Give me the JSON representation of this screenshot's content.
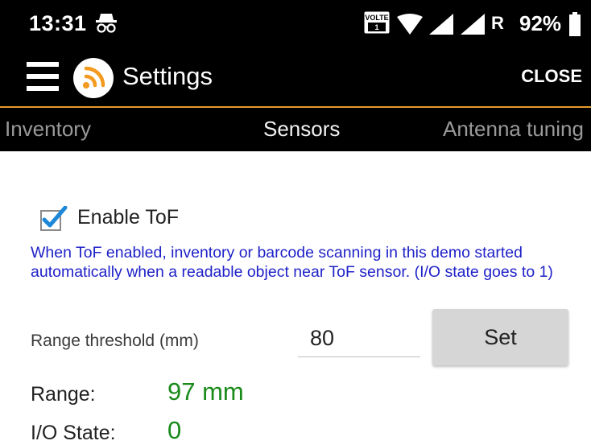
{
  "status_bar": {
    "time": "13:31",
    "roaming": "R",
    "battery_percent": "92%",
    "icons": [
      "incognito-icon",
      "volte-icon",
      "wifi-icon",
      "signal-icon",
      "signal-icon",
      "battery-icon"
    ],
    "battery_level": 0.92
  },
  "toolbar": {
    "title": "Settings",
    "close_label": "CLOSE",
    "accent_color": "#e69b2a"
  },
  "tabs": [
    {
      "label": "Inventory",
      "selected": false
    },
    {
      "label": "Sensors",
      "selected": true
    },
    {
      "label": "Antenna tuning",
      "selected": false
    }
  ],
  "tof": {
    "checkbox_label": "Enable ToF",
    "checked": true,
    "info_text": "When ToF enabled, inventory or barcode scanning in this demo started automatically when a readable object near ToF sensor. (I/O state goes to 1)",
    "info_color": "#1f22c8",
    "range_threshold_label": "Range threshold (mm)",
    "range_threshold_value": "80",
    "set_label": "Set",
    "range_label": "Range:",
    "range_value": "97 mm",
    "io_state_label": "I/O State:",
    "io_state_value": "0",
    "value_color": "#1a8a1a"
  }
}
